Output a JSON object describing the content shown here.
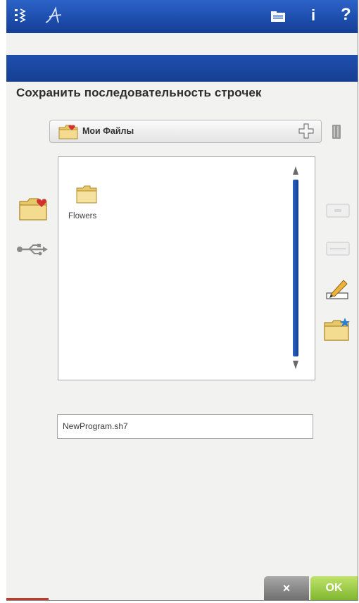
{
  "title": "Сохранить последовательность строчек",
  "location": {
    "label": "Мои Файлы"
  },
  "files": [
    {
      "name": "Flowers",
      "type": "folder"
    }
  ],
  "filename": {
    "value": "NewProgram.sh7"
  },
  "buttons": {
    "cancel": "×",
    "ok": "OK"
  },
  "topbar": {
    "info": "i",
    "help": "?"
  },
  "colors": {
    "topbar": "#1c4dac",
    "ok": "#8cc63f",
    "cancel": "#8a8a8a",
    "accent": "#c0392b"
  }
}
